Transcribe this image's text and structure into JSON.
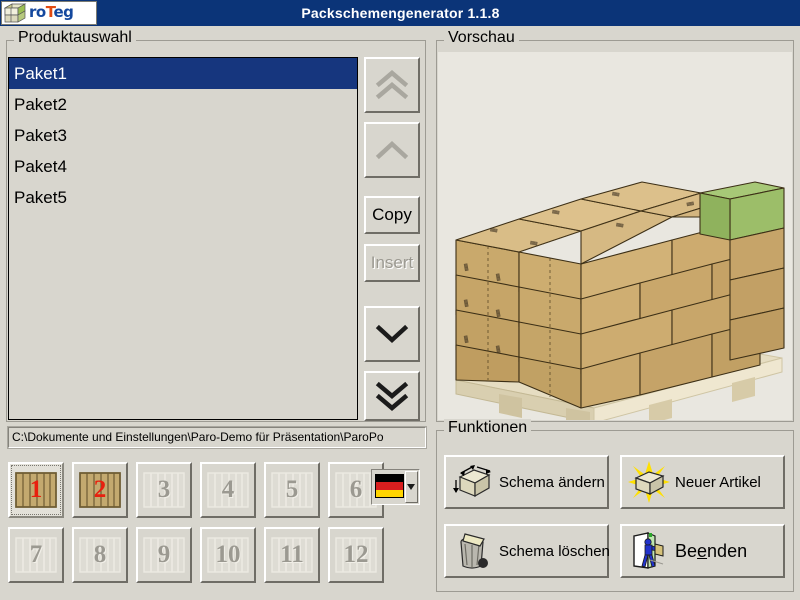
{
  "window": {
    "title": "Packschemengenerator 1.1.8",
    "logo_text_1": "ro",
    "logo_text_2": "T",
    "logo_text_3": "eg",
    "logo_icon": "roteg-cube-logo",
    "titlebar_color": "#0b3478"
  },
  "product_panel": {
    "legend": "Produktauswahl",
    "items": [
      {
        "label": "Paket1",
        "selected": true
      },
      {
        "label": "Paket2",
        "selected": false
      },
      {
        "label": "Paket3",
        "selected": false
      },
      {
        "label": "Paket4",
        "selected": false
      },
      {
        "label": "Paket5",
        "selected": false
      }
    ],
    "selection_color": "#16367e",
    "nav": {
      "move_top": {
        "icon": "double-chevron-up-icon",
        "enabled": false
      },
      "move_up": {
        "icon": "chevron-up-icon",
        "enabled": false
      },
      "copy": {
        "label": "Copy",
        "enabled": true
      },
      "insert": {
        "label": "Insert",
        "enabled": false
      },
      "move_down": {
        "icon": "chevron-down-icon",
        "enabled": true
      },
      "move_bottom": {
        "icon": "double-chevron-down-icon",
        "enabled": true
      }
    },
    "path": "C:\\Dokumente und Einstellungen\\Paro-Demo für Präsentation\\ParoPo",
    "pallet_buttons": [
      {
        "number": "1",
        "enabled": true,
        "focused": true
      },
      {
        "number": "2",
        "enabled": true,
        "focused": false
      },
      {
        "number": "3",
        "enabled": false,
        "focused": false
      },
      {
        "number": "4",
        "enabled": false,
        "focused": false
      },
      {
        "number": "5",
        "enabled": false,
        "focused": false
      },
      {
        "number": "6",
        "enabled": false,
        "focused": false
      },
      {
        "number": "7",
        "enabled": false,
        "focused": false
      },
      {
        "number": "8",
        "enabled": false,
        "focused": false
      },
      {
        "number": "9",
        "enabled": false,
        "focused": false
      },
      {
        "number": "10",
        "enabled": false,
        "focused": false
      },
      {
        "number": "11",
        "enabled": false,
        "focused": false
      },
      {
        "number": "12",
        "enabled": false,
        "focused": false
      }
    ],
    "language_combo": {
      "icon": "german-flag-icon",
      "selected": "Deutsch",
      "arrow_icon": "chevron-down-icon",
      "flag_colors": [
        "#000000",
        "#d81e1e",
        "#ffd400"
      ]
    }
  },
  "preview_panel": {
    "legend": "Vorschau",
    "render": {
      "icon": "pallet-3d-render",
      "background": "#e9e7e0",
      "carton_color": "#c8a973",
      "carton_top_color": "#d8bb84",
      "highlight_color": "#9ec16a",
      "pallet_color": "#e0d7bb",
      "layers": 4,
      "boxes_per_layer": 8
    }
  },
  "functions_panel": {
    "legend": "Funktionen",
    "buttons": [
      {
        "label": "Schema ändern",
        "icon": "box-dimensions-icon"
      },
      {
        "label": "Neuer Artikel",
        "icon": "new-box-sparkle-icon"
      },
      {
        "label": "Schema löschen",
        "icon": "trash-can-icon"
      },
      {
        "label": "Beenden",
        "icon": "exit-door-icon"
      }
    ]
  }
}
